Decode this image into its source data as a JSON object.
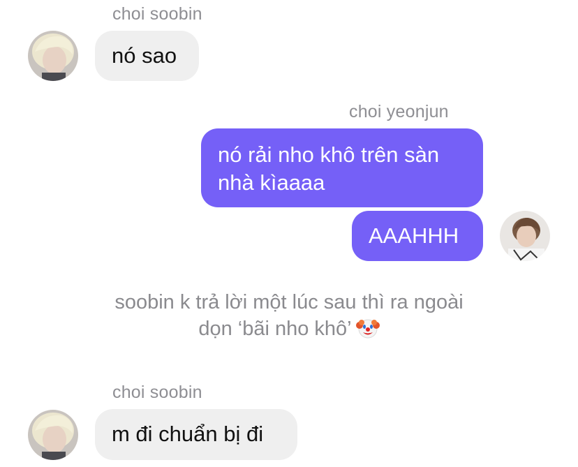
{
  "messages": [
    {
      "sender": "choi soobin",
      "text": "nó sao"
    },
    {
      "sender": "choi yeonjun",
      "text": "nó rải nho khô trên sàn nhà kìaaaa"
    },
    {
      "text": "AAAHHH"
    },
    {
      "sender": "choi soobin",
      "text": "m đi chuẩn bị đi"
    }
  ],
  "system_note": {
    "line1": "soobin k trả lời một lúc sau thì ra ngoài",
    "line2": "dọn ‘bãi nho khô’",
    "emoji": "clown-face-icon"
  },
  "colors": {
    "outgoing_bubble": "#7560f7",
    "incoming_bubble": "#efefef",
    "sender_name": "#8e8e93",
    "caption_text": "#8a8a8e"
  }
}
